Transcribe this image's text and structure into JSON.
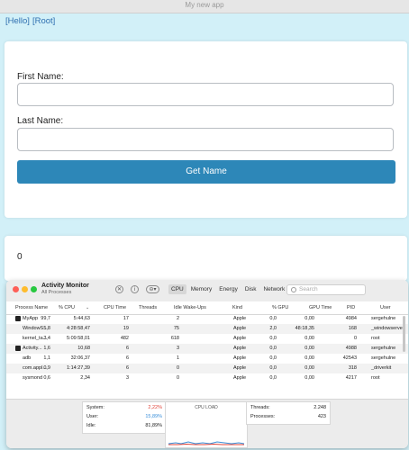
{
  "app": {
    "title": "My new app",
    "breadcrumb": [
      "[Hello]",
      "[Root]"
    ],
    "form": {
      "first_name_label": "First Name:",
      "last_name_label": "Last Name:",
      "first_name_value": "",
      "last_name_value": "",
      "button_label": "Get Name"
    },
    "result": "0",
    "colors": {
      "background": "#d2f0f8",
      "button": "#2d87b8",
      "link": "#2f6fb0"
    }
  },
  "activity_monitor": {
    "title": "Activity Monitor",
    "subtitle": "All Processes",
    "toolbar_icons": [
      "close-icon",
      "info-icon",
      "view-options-icon"
    ],
    "tabs": [
      "CPU",
      "Memory",
      "Energy",
      "Disk",
      "Network"
    ],
    "active_tab": "CPU",
    "search_placeholder": "Search",
    "columns": [
      "Process Name",
      "% CPU",
      "CPU Time",
      "Threads",
      "Idle Wake-Ups",
      "Kind",
      "% GPU",
      "GPU Time",
      "PID",
      "User"
    ],
    "rows": [
      {
        "name": "MyApp",
        "cpu": "99,7",
        "cpu_time": "5:44,63",
        "threads": "17",
        "idle": "2",
        "kind": "Apple",
        "gpu": "0,0",
        "gpu_time": "0,00",
        "pid": "4984",
        "user": "sergehulne",
        "icon": true
      },
      {
        "name": "WindowS...",
        "cpu": "5,8",
        "cpu_time": "4:28:58,47",
        "threads": "19",
        "idle": "75",
        "kind": "Apple",
        "gpu": "2,0",
        "gpu_time": "48:18,35",
        "pid": "168",
        "user": "_windowserver",
        "icon": false
      },
      {
        "name": "kernel_ta...",
        "cpu": "3,4",
        "cpu_time": "5:09:58,01",
        "threads": "482",
        "idle": "618",
        "kind": "Apple",
        "gpu": "0,0",
        "gpu_time": "0,00",
        "pid": "0",
        "user": "root",
        "icon": false
      },
      {
        "name": "Activity...",
        "cpu": "1,6",
        "cpu_time": "10,68",
        "threads": "6",
        "idle": "3",
        "kind": "Apple",
        "gpu": "0,0",
        "gpu_time": "0,00",
        "pid": "4988",
        "user": "sergehulne",
        "icon": true
      },
      {
        "name": "adb",
        "cpu": "1,1",
        "cpu_time": "32:06,37",
        "threads": "6",
        "idle": "1",
        "kind": "Apple",
        "gpu": "0,0",
        "gpu_time": "0,00",
        "pid": "42543",
        "user": "sergehulne",
        "icon": false
      },
      {
        "name": "com.appl...",
        "cpu": "0,9",
        "cpu_time": "1:14:27,39",
        "threads": "6",
        "idle": "0",
        "kind": "Apple",
        "gpu": "0,0",
        "gpu_time": "0,00",
        "pid": "318",
        "user": "_driverkit",
        "icon": false
      },
      {
        "name": "sysmond",
        "cpu": "0,6",
        "cpu_time": "2,34",
        "threads": "3",
        "idle": "0",
        "kind": "Apple",
        "gpu": "0,0",
        "gpu_time": "0,00",
        "pid": "4217",
        "user": "root",
        "icon": false
      }
    ],
    "footer": {
      "system_label": "System:",
      "system_value": "2,22%",
      "system_color": "#e0443a",
      "user_label": "User:",
      "user_value": "15,89%",
      "user_color": "#3a8fd9",
      "idle_label": "Idle:",
      "idle_value": "81,89%",
      "cpu_load_label": "CPU LOAD",
      "threads_label": "Threads:",
      "threads_value": "2.248",
      "processes_label": "Processes:",
      "processes_value": "423"
    }
  }
}
